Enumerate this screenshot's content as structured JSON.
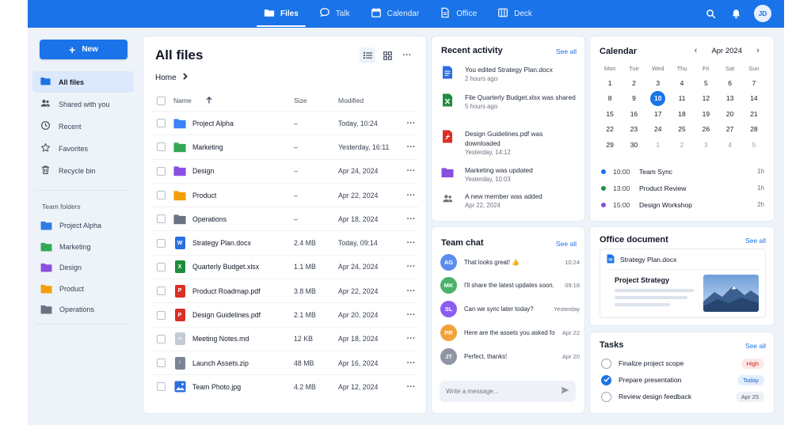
{
  "topbar": {
    "nav": [
      {
        "label": "Files",
        "icon": "folder-icon",
        "active": true
      },
      {
        "label": "Talk",
        "icon": "chat-bubble-icon",
        "active": false
      },
      {
        "label": "Calendar",
        "icon": "calendar-icon",
        "active": false
      },
      {
        "label": "Office",
        "icon": "document-icon",
        "active": false
      },
      {
        "label": "Deck",
        "icon": "board-icon",
        "active": false
      }
    ],
    "avatar_initials": "JD"
  },
  "sidebar": {
    "new_label": "New",
    "items": [
      {
        "label": "All files",
        "icon": "folder-icon"
      },
      {
        "label": "Shared with you",
        "icon": "people-icon"
      },
      {
        "label": "Recent",
        "icon": "clock-icon"
      },
      {
        "label": "Favorites",
        "icon": "star-icon"
      },
      {
        "label": "Recycle bin",
        "icon": "trash-icon"
      }
    ],
    "team_folders_label": "Team folders",
    "team_folders": [
      {
        "label": "Project Alpha",
        "color": "#2f7de1"
      },
      {
        "label": "Marketing",
        "color": "#34a853"
      },
      {
        "label": "Design",
        "color": "#8a4fe0"
      },
      {
        "label": "Product",
        "color": "#f59e0b"
      },
      {
        "label": "Operations",
        "color": "#6b7280"
      }
    ]
  },
  "files": {
    "title": "All files",
    "breadcrumb": "Home",
    "columns": {
      "name": "Name",
      "size": "Size",
      "modified": "Modified"
    },
    "rows": [
      {
        "name": "Project Alpha",
        "type": "folder",
        "color": "#3b82f6",
        "size": "–",
        "modified": "Today, 10:24"
      },
      {
        "name": "Marketing",
        "type": "folder",
        "color": "#34a853",
        "size": "–",
        "modified": "Yesterday, 16:11"
      },
      {
        "name": "Design",
        "type": "folder",
        "color": "#8a4fe0",
        "size": "–",
        "modified": "Apr 24, 2024"
      },
      {
        "name": "Product",
        "type": "folder",
        "color": "#f59e0b",
        "size": "–",
        "modified": "Apr 22, 2024"
      },
      {
        "name": "Operations",
        "type": "folder",
        "color": "#6b7280",
        "size": "–",
        "modified": "Apr 18, 2024"
      },
      {
        "name": "Strategy Plan.docx",
        "type": "doc",
        "badge": "W",
        "color": "#2b6fe0",
        "size": "2.4 MB",
        "modified": "Today, 09:14"
      },
      {
        "name": "Quarterly Budget.xlsx",
        "type": "doc",
        "badge": "X",
        "color": "#1e8e3e",
        "size": "1.1 MB",
        "modified": "Apr 24, 2024"
      },
      {
        "name": "Product Roadmap.pdf",
        "type": "doc",
        "badge": "P",
        "color": "#d93025",
        "size": "3.8 MB",
        "modified": "Apr 22, 2024"
      },
      {
        "name": "Design Guidelines.pdf",
        "type": "doc",
        "badge": "P",
        "color": "#d93025",
        "size": "2.1 MB",
        "modified": "Apr 20, 2024"
      },
      {
        "name": "Meeting Notes.md",
        "type": "doc",
        "badge": "≡",
        "color": "#c5cbd3",
        "size": "12 KB",
        "modified": "Apr 18, 2024"
      },
      {
        "name": "Launch Assets.zip",
        "type": "doc",
        "badge": "↑",
        "color": "#7b8594",
        "size": "48 MB",
        "modified": "Apr 16, 2024"
      },
      {
        "name": "Team Photo.jpg",
        "type": "image",
        "color": "#2b6fe0",
        "size": "4.2 MB",
        "modified": "Apr 12, 2024"
      }
    ]
  },
  "recent_activity": {
    "title": "Recent activity",
    "see_all": "See all",
    "items": [
      {
        "text": "You edited Strategy Plan.docx",
        "time": "2 hours ago",
        "icon": "word-doc-icon",
        "color": "#2b6fe0"
      },
      {
        "text": "File Quarterly Budget.xlsx was shared",
        "time": "5 hours ago",
        "icon": "excel-doc-icon",
        "color": "#1e8e3e"
      },
      {
        "text": "Design Guidelines.pdf was downloaded",
        "time": "Yesterday, 14:12",
        "icon": "pdf-doc-icon",
        "color": "#d93025"
      },
      {
        "text": "Marketing was updated",
        "time": "Yesterday, 10:03",
        "icon": "folder-icon",
        "color": "#8a4fe0"
      },
      {
        "text": "A new member was added",
        "time": "Apr 22, 2024",
        "icon": "people-icon",
        "color": "#6b7280"
      }
    ]
  },
  "team_chat": {
    "title": "Team chat",
    "see_all": "See all",
    "placeholder": "Write a message...",
    "messages": [
      {
        "initials": "AG",
        "color": "#5b8def",
        "text": "That looks great! 👍",
        "time": "10:24"
      },
      {
        "initials": "MK",
        "color": "#49b36a",
        "text": "I'll share the latest updates soon.",
        "time": "09:18"
      },
      {
        "initials": "SL",
        "color": "#8a5cf0",
        "text": "Can we sync later today?",
        "time": "Yesterday"
      },
      {
        "initials": "PR",
        "color": "#f2a23c",
        "text": "Here are the assets you asked for.",
        "time": "Apr 22"
      },
      {
        "initials": "JT",
        "color": "#8f96a3",
        "text": "Perfect, thanks!",
        "time": "Apr 20"
      }
    ]
  },
  "calendar": {
    "title": "Calendar",
    "month": "Apr 2024",
    "weekdays": [
      "Mon",
      "Tue",
      "Wed",
      "Thu",
      "Fri",
      "Sat",
      "Sun"
    ],
    "days": [
      {
        "d": "1"
      },
      {
        "d": "2"
      },
      {
        "d": "3"
      },
      {
        "d": "4"
      },
      {
        "d": "5"
      },
      {
        "d": "6"
      },
      {
        "d": "7"
      },
      {
        "d": "8"
      },
      {
        "d": "9"
      },
      {
        "d": "10",
        "today": true
      },
      {
        "d": "11"
      },
      {
        "d": "12"
      },
      {
        "d": "13"
      },
      {
        "d": "14"
      },
      {
        "d": "15"
      },
      {
        "d": "16"
      },
      {
        "d": "17"
      },
      {
        "d": "18"
      },
      {
        "d": "19"
      },
      {
        "d": "20"
      },
      {
        "d": "21"
      },
      {
        "d": "22"
      },
      {
        "d": "23"
      },
      {
        "d": "24"
      },
      {
        "d": "25"
      },
      {
        "d": "26"
      },
      {
        "d": "27"
      },
      {
        "d": "28"
      },
      {
        "d": "29"
      },
      {
        "d": "30"
      },
      {
        "d": "1",
        "muted": true
      },
      {
        "d": "2",
        "muted": true
      },
      {
        "d": "3",
        "muted": true
      },
      {
        "d": "4",
        "muted": true
      },
      {
        "d": "5",
        "muted": true
      }
    ],
    "events": [
      {
        "time": "10:00",
        "title": "Team Sync",
        "duration": "1h",
        "color": "#1a73e8"
      },
      {
        "time": "13:00",
        "title": "Product Review",
        "duration": "1h",
        "color": "#1e8e3e"
      },
      {
        "time": "15:00",
        "title": "Design Workshop",
        "duration": "2h",
        "color": "#8a4fe0"
      }
    ]
  },
  "office": {
    "title": "Office document",
    "see_all": "See all",
    "file_name": "Strategy Plan.docx",
    "doc_title": "Project Strategy"
  },
  "tasks": {
    "title": "Tasks",
    "see_all": "See all",
    "items": [
      {
        "label": "Finalize project scope",
        "done": false,
        "tag": "High",
        "tag_bg": "#fde8e8",
        "tag_color": "#c5221f"
      },
      {
        "label": "Prepare presentation",
        "done": true,
        "tag": "Today",
        "tag_bg": "#e3eefc",
        "tag_color": "#1a5fc7"
      },
      {
        "label": "Review design feedback",
        "done": false,
        "tag": "Apr 25",
        "tag_bg": "#eef1f5",
        "tag_color": "#4b5563"
      }
    ]
  }
}
